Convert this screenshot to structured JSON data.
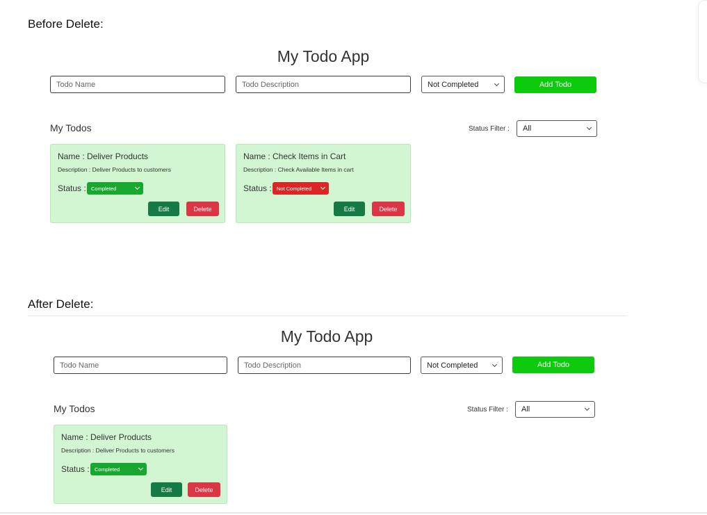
{
  "before_label": "Before Delete:",
  "after_label": "After Delete:",
  "before": {
    "title": "My Todo App",
    "name_placeholder": "Todo Name",
    "description_placeholder": "Todo Description",
    "status_select_value": "Not Completed",
    "add_button": "Add Todo",
    "my_todos_heading": "My Todos",
    "filter_label": "Status Filter :",
    "filter_value": "All",
    "todos": [
      {
        "name": "Name : Deliver Products",
        "description": "Description : Deliver Products to customers",
        "status_label": "Status :",
        "status_value": "Completed",
        "status_color": "#18a830",
        "edit": "Edit",
        "delete": "Delete"
      },
      {
        "name": "Name : Check Items in Cart",
        "description": "Description : Check Available Items in cart",
        "status_label": "Status :",
        "status_value": "Not Completed",
        "status_color": "#dc2626",
        "edit": "Edit",
        "delete": "Delete"
      }
    ]
  },
  "after": {
    "title": "My Todo App",
    "name_placeholder": "Todo Name",
    "description_placeholder": "Todo Description",
    "status_select_value": "Not Completed",
    "add_button": "Add Todo",
    "my_todos_heading": "My Todos",
    "filter_label": "Status Filter :",
    "filter_value": "All",
    "todos": [
      {
        "name": "Name : Deliver Products",
        "description": "Description : Deliver Products to customers",
        "status_label": "Status :",
        "status_value": "Completed",
        "status_color": "#18a830",
        "edit": "Edit",
        "delete": "Delete"
      }
    ]
  },
  "colors": {
    "add_button": "#0ccb0c",
    "card_background": "#d2f5d2",
    "edit_button": "#157a45",
    "delete_button": "#dc3545"
  }
}
